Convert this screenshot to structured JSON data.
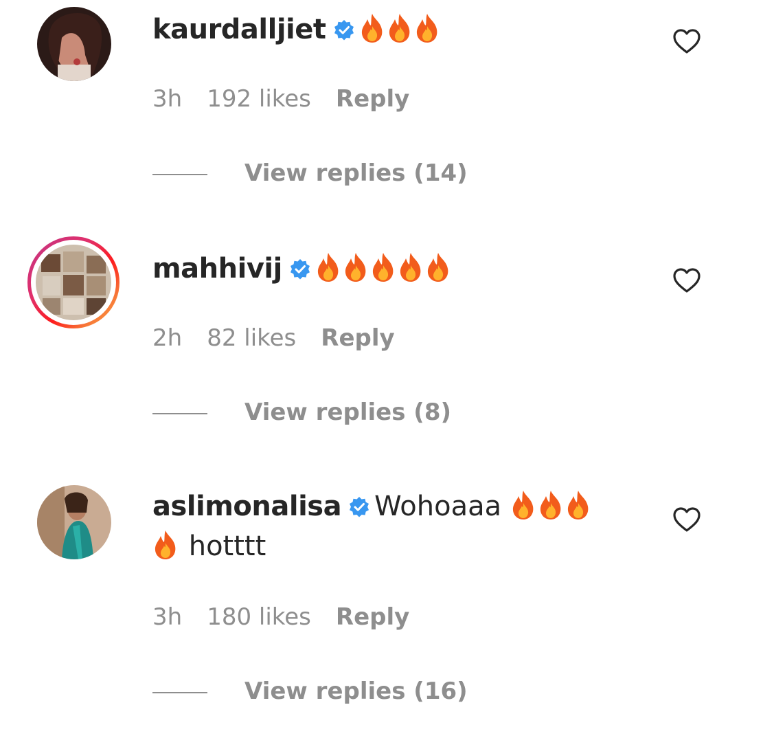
{
  "comments": [
    {
      "username": "kaurdalljiet",
      "time": "3h",
      "likes": "192 likes",
      "reply": "Reply",
      "view_replies": "View replies (14)",
      "fires": 3
    },
    {
      "username": "mahhivij",
      "time": "2h",
      "likes": "82 likes",
      "reply": "Reply",
      "view_replies": "View replies (8)",
      "fires": 5
    },
    {
      "username": "aslimonalisa",
      "text1": "Wohoaaa",
      "text2": "hotttt",
      "time": "3h",
      "likes": "180 likes",
      "reply": "Reply",
      "view_replies": "View replies (16)",
      "fires": 4
    }
  ],
  "colors": {
    "verified": "#3897f0",
    "secondary": "#8e8e8e",
    "primary": "#262626"
  },
  "icons": {
    "verified": "verified-badge-icon",
    "like": "heart-outline-icon",
    "emoji": "fire-emoji"
  }
}
